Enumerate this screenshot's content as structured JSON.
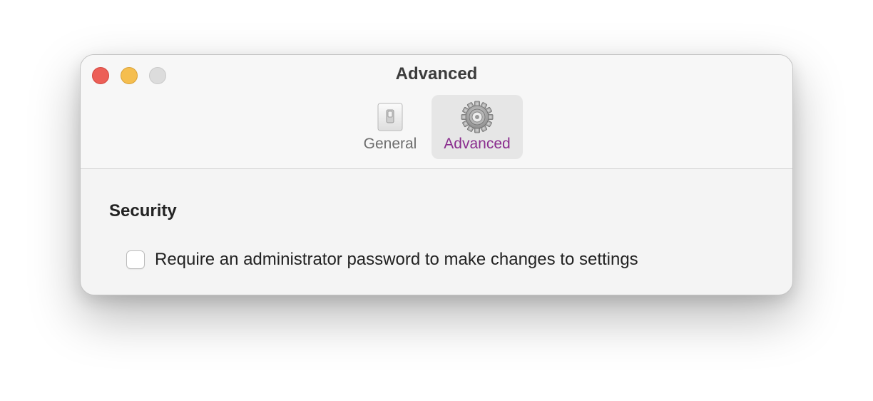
{
  "window": {
    "title": "Advanced"
  },
  "toolbar": {
    "items": [
      {
        "label": "General",
        "icon": "switch-icon",
        "selected": false
      },
      {
        "label": "Advanced",
        "icon": "gear-icon",
        "selected": true
      }
    ]
  },
  "content": {
    "section_heading": "Security",
    "options": [
      {
        "label": "Require an administrator password to make changes to settings",
        "checked": false
      }
    ]
  },
  "colors": {
    "close": "#ec5f57",
    "minimize": "#f5be4f",
    "zoom_inactive": "#dcdcdc",
    "accent": "#8a2d8e"
  }
}
